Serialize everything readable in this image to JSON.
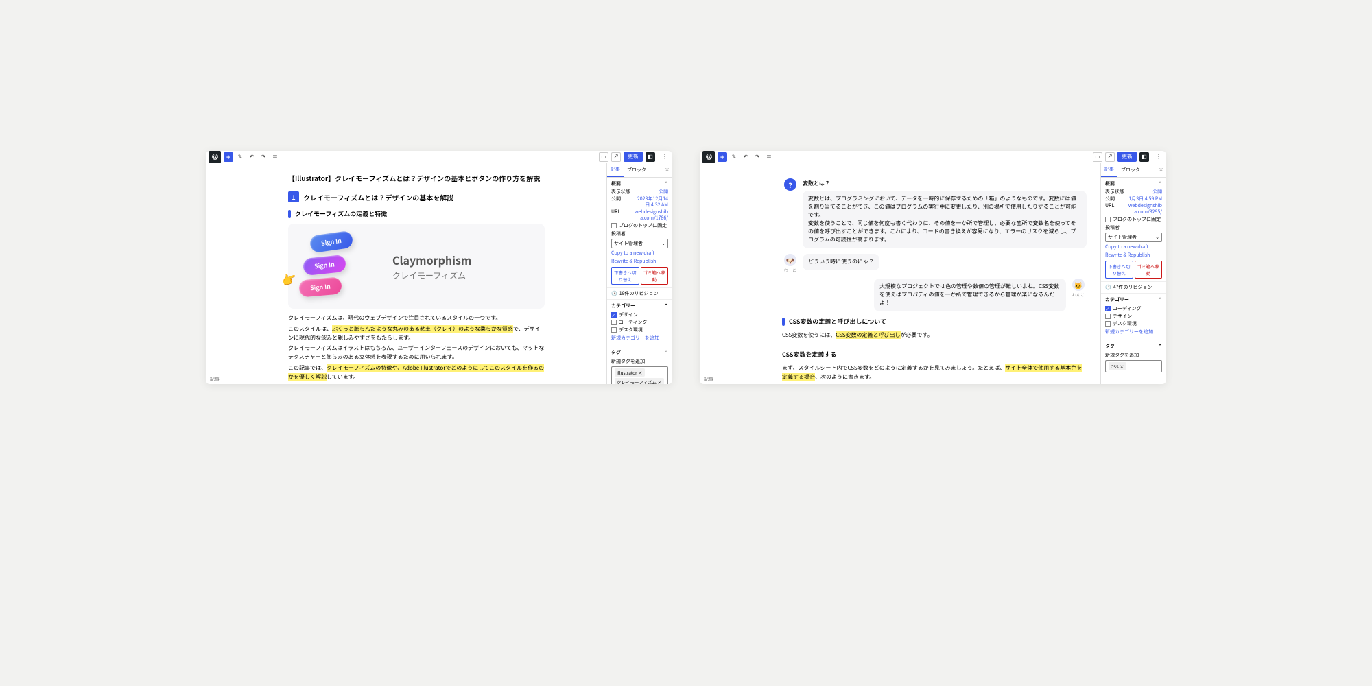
{
  "left": {
    "toolbar": {
      "update": "更新"
    },
    "article": {
      "title": "【Illustrator】クレイモーフィズムとは？デザインの基本とボタンの作り方を解説",
      "h1_num": "1",
      "h1": "クレイモーフィズムとは？デザインの基本を解説",
      "h2": "クレイモーフィズムの定義と特徴",
      "clay_en": "Claymorphism",
      "clay_jp": "クレイモーフィズム",
      "sign": "Sign In",
      "p1": "クレイモーフィズムは、現代のウェブデザインで注目されているスタイルの一つです。",
      "p2a": "このスタイルは、",
      "p2b": "ぷくっと膨らんだような丸みのある粘土（クレイ）のような柔らかな質感",
      "p2c": "で、デザインに現代的な深みと親しみやすさをもたらします。",
      "p3": "クレイモーフィズムはイラストはもちろん、ユーザーインターフェースのデザインにおいても、マットなテクスチャーと膨らみのある立体感を表現するために用いられます。",
      "p4a": "この記事では、",
      "p4b": "クレイモーフィズムの特徴や、Adobe Illustratorでどのようにしてこのスタイルを作るのかを優しく解説",
      "p4c": "しています。"
    },
    "sb": {
      "tab1": "記事",
      "tab2": "ブロック",
      "summary": "概要",
      "status_l": "表示状態",
      "status_v": "公開",
      "pub_l": "公開",
      "pub_v": "2023年12月14日 4:32 AM",
      "url_l": "URL",
      "url_v": "webdesignshiba.com/1786/",
      "pin": "ブログのトップに固定",
      "author_l": "投稿者",
      "author_v": "サイト管理者",
      "copy": "Copy to a new draft",
      "rewrite": "Rewrite & Republish",
      "draft_btn": "下書きへ切り替え",
      "trash_btn": "ゴミ箱へ移動",
      "rev": "19件のリビジョン",
      "cat": "カテゴリー",
      "c1": "デザイン",
      "c2": "コーディング",
      "c3": "デスク環境",
      "newcat": "新規カテゴリーを追加",
      "tags": "タグ",
      "newtag": "新規タグを追加",
      "t1": "Illustrator ×",
      "t2": "クレイモーフィズム ×"
    },
    "footer": "記事"
  },
  "right": {
    "toolbar": {
      "update": "更新"
    },
    "chat": {
      "q1": "変数とは？",
      "a1": "変数とは、プログラミングにおいて、データを一時的に保存するための「箱」のようなものです。変数には値を割り当てることができ、この値はプログラムの実行中に変更したり、別の場所で使用したりすることが可能です。",
      "a1b": "変数を使うことで、同じ値を何度も書く代わりに、その値を一か所で管理し、必要な箇所で変数名を使ってその値を呼び出すことができます。これにより、コードの書き換えが容易になり、エラーのリスクを減らし、プログラムの可読性が高まります。",
      "n1": "わーこ",
      "q2": "どういう時に使うのにゃ？",
      "a2": "大規模なプロジェクトでは色の管理や数値の管理が難しいよね。CSS変数を使えばプロパティの値を一か所で管理できるから管理が楽になるんだよ！",
      "n2": "わんこ"
    },
    "article": {
      "h2a": "CSS変数の定義と呼び出しについて",
      "p1a": "CSS変数を使うには、",
      "p1b": "CSS変数の定義と呼び出し",
      "p1c": "が必要です。",
      "h2b": "CSS変数を定義する",
      "p2a": "まず、スタイルシート内でCSS変数をどのように定義するかを見てみましょう。たとえば、",
      "p2b": "サイト全体で使用する基本色を定義する場合",
      "p2c": "、次のように書きます。"
    },
    "sb": {
      "tab1": "記事",
      "tab2": "ブロック",
      "summary": "概要",
      "status_l": "表示状態",
      "status_v": "公開",
      "pub_l": "公開",
      "pub_v": "1月3日 4:59 PM",
      "url_l": "URL",
      "url_v": "webdesignshiba.com/3295/",
      "pin": "ブログのトップに固定",
      "author_l": "投稿者",
      "author_v": "サイト管理者",
      "copy": "Copy to a new draft",
      "rewrite": "Rewrite & Republish",
      "draft_btn": "下書きへ切り替え",
      "trash_btn": "ゴミ箱へ移動",
      "rev": "47件のリビジョン",
      "cat": "カテゴリー",
      "c1": "コーディング",
      "c2": "デザイン",
      "c3": "デスク環境",
      "newcat": "新規カテゴリーを追加",
      "tags": "タグ",
      "newtag": "新規タグを追加",
      "t1": "CSS ×"
    },
    "footer": "記事"
  }
}
